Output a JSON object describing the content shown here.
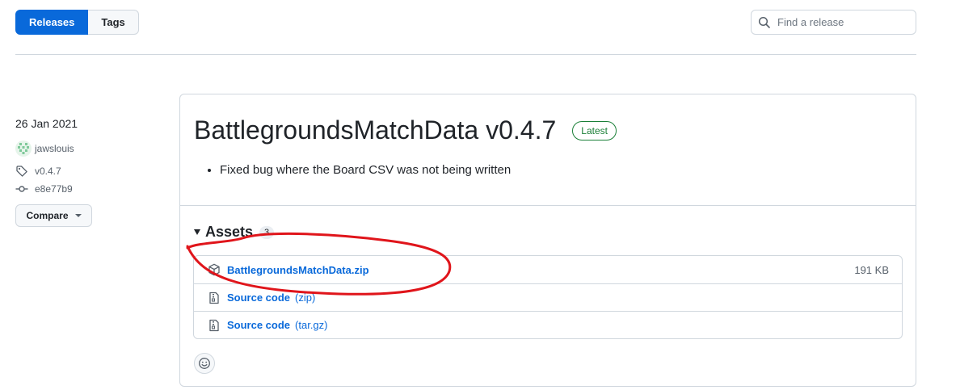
{
  "tabs": {
    "releases": "Releases",
    "tags": "Tags"
  },
  "search": {
    "placeholder": "Find a release"
  },
  "release": {
    "date": "26 Jan 2021",
    "author": "jawslouis",
    "tag": "v0.4.7",
    "commit": "e8e77b9",
    "compare_label": "Compare",
    "title": "BattlegroundsMatchData v0.4.7",
    "badge": "Latest",
    "notes": [
      "Fixed bug where the Board CSV was not being written"
    ]
  },
  "assets": {
    "label": "Assets",
    "count": "3",
    "items": [
      {
        "name": "BattlegroundsMatchData.zip",
        "sub": "",
        "size": "191 KB",
        "icon": "package-icon"
      },
      {
        "name": "Source code",
        "sub": "(zip)",
        "size": "",
        "icon": "file-zip-icon"
      },
      {
        "name": "Source code",
        "sub": "(tar.gz)",
        "size": "",
        "icon": "file-zip-icon"
      }
    ]
  },
  "colors": {
    "accent": "#0969da",
    "latest": "#1a7f37",
    "annotation": "#e0151b"
  }
}
